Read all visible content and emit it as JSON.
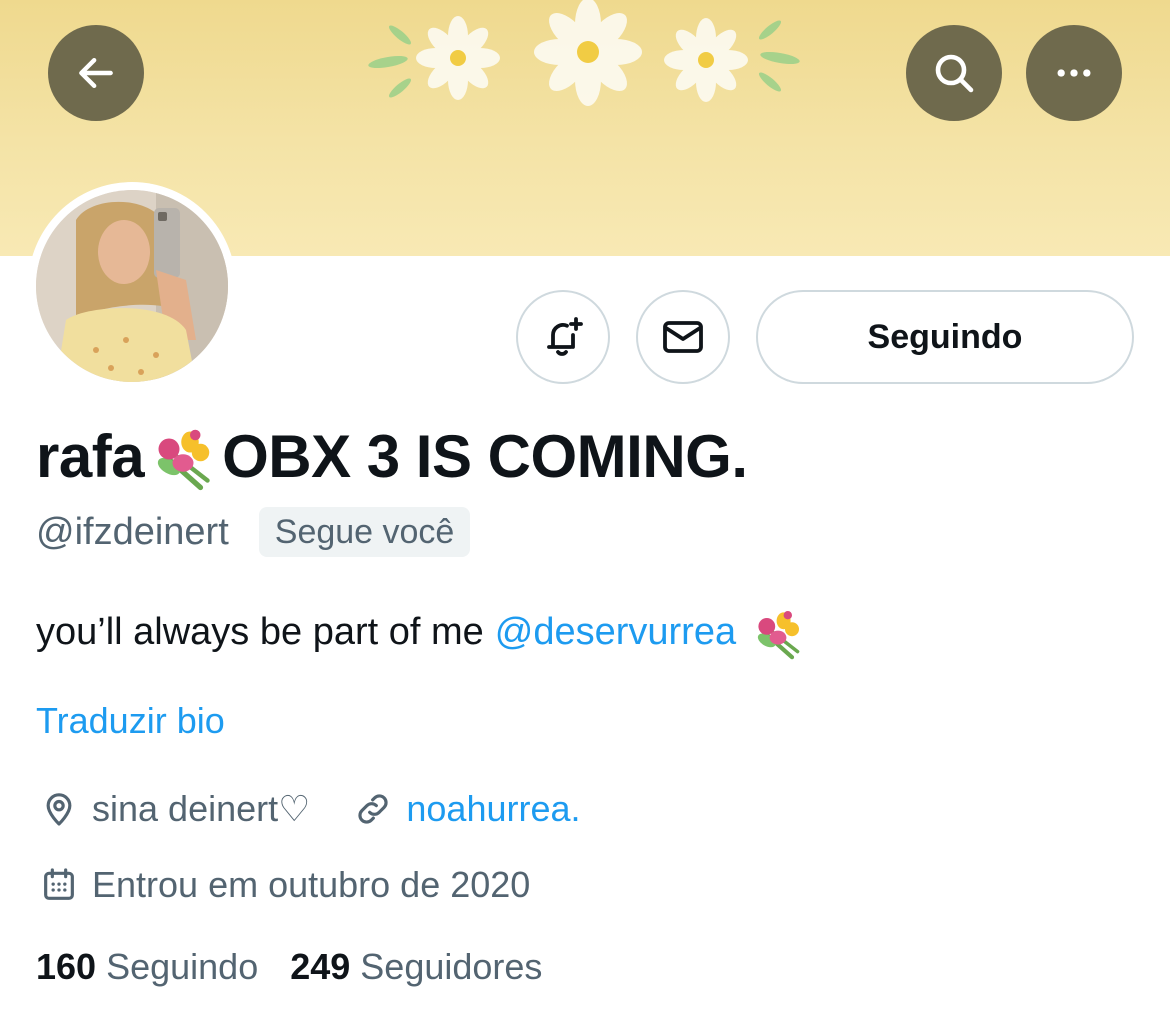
{
  "banner": {
    "colors": {
      "background": "#f4e3a6",
      "button": "#6f6a4d"
    }
  },
  "toolbar": {
    "back_icon": "arrow-left-icon",
    "search_icon": "search-icon",
    "more_icon": "more-horizontal-icon"
  },
  "actions": {
    "notify_icon": "bell-plus-icon",
    "message_icon": "envelope-icon",
    "follow_label": "Seguindo"
  },
  "profile": {
    "name_prefix": "rafa",
    "name_emoji": "bouquet-emoji",
    "name_suffix": "OBX 3 IS COMING.",
    "handle": "@ifzdeinert",
    "follows_you": "Segue você",
    "bio_text": "you’ll always be part of me",
    "bio_mention": "@deservurrea",
    "translate_label": "Traduzir bio",
    "location": "sina deinert♡",
    "website": "noahurrea.",
    "joined": "Entrou em outubro de 2020",
    "following_count": "160",
    "following_label": "Seguindo",
    "followers_count": "249",
    "followers_label": "Seguidores"
  },
  "colors": {
    "link": "#1d9bf0",
    "secondary_text": "#536471",
    "primary_text": "#0f1419",
    "border": "#cfd9de"
  }
}
